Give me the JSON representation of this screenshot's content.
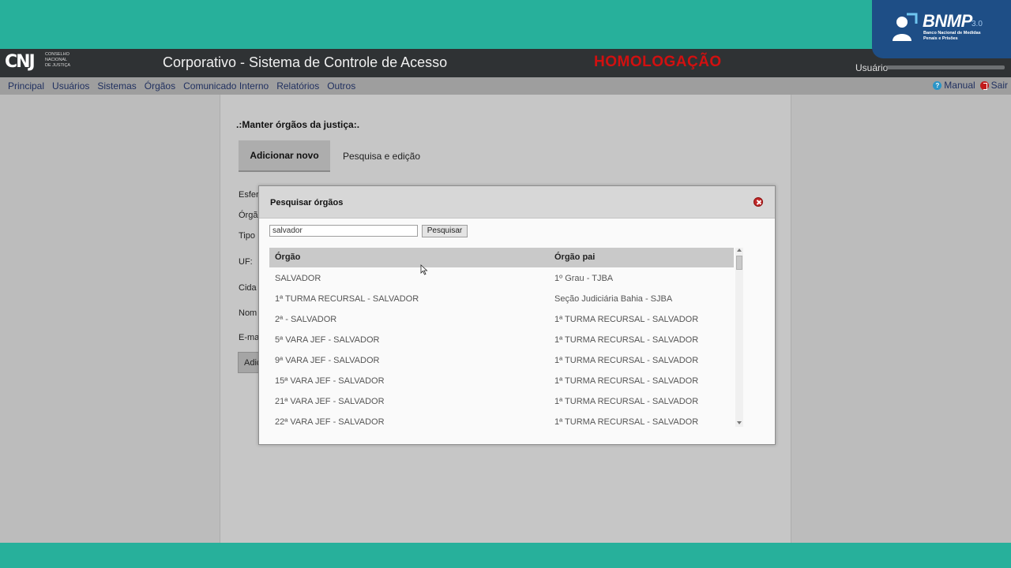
{
  "bnmp": {
    "title": "BNMP",
    "version": "3.0",
    "subtitle": "Banco Nacional de Medidas Penais e Prisões"
  },
  "header": {
    "logo_text": "CNJ",
    "logo_sub": [
      "CONSELHO",
      "NACIONAL",
      "DE JUSTIÇA"
    ],
    "title": "Corporativo - Sistema de Controle de Acesso",
    "environment": "HOMOLOGAÇÃO",
    "user_label": "Usuário"
  },
  "menu": {
    "items": [
      "Principal",
      "Usuários",
      "Sistemas",
      "Órgãos",
      "Comunicado Interno",
      "Relatórios",
      "Outros"
    ],
    "manual": "Manual",
    "exit": "Sair"
  },
  "page": {
    "heading": ".:Manter órgãos da justiça:.",
    "tabs": [
      "Adicionar novo",
      "Pesquisa e edição"
    ],
    "form_labels": [
      "Esfer",
      "Órgã",
      "Tipo",
      "UF:",
      "Cida",
      "Nom",
      "E-ma"
    ],
    "add_button": "Adic"
  },
  "modal": {
    "title": "Pesquisar órgãos",
    "search_value": "salvador",
    "search_button": "Pesquisar",
    "columns": [
      "Órgão",
      "Órgão pai"
    ],
    "rows": [
      [
        "SALVADOR",
        "1º Grau - TJBA"
      ],
      [
        "1ª TURMA RECURSAL - SALVADOR",
        "Seção Judiciária Bahia - SJBA"
      ],
      [
        "2ª - SALVADOR",
        "1ª TURMA RECURSAL - SALVADOR"
      ],
      [
        "5ª VARA JEF - SALVADOR",
        "1ª TURMA RECURSAL - SALVADOR"
      ],
      [
        "9ª VARA JEF - SALVADOR",
        "1ª TURMA RECURSAL - SALVADOR"
      ],
      [
        "15ª VARA JEF - SALVADOR",
        "1ª TURMA RECURSAL - SALVADOR"
      ],
      [
        "21ª VARA JEF - SALVADOR",
        "1ª TURMA RECURSAL - SALVADOR"
      ],
      [
        "22ª VARA JEF - SALVADOR",
        "1ª TURMA RECURSAL - SALVADOR"
      ]
    ]
  },
  "colors": {
    "teal_frame": "#27b09b",
    "header_bg": "#2f3234",
    "environment_red": "#d21010",
    "bnmp_blue": "#1e4e86"
  }
}
